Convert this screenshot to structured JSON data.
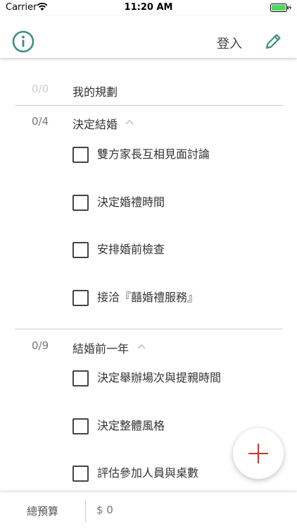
{
  "status_bar": {
    "carrier": "Carrier",
    "time": "11:20 AM"
  },
  "navbar": {
    "login_label": "登入"
  },
  "plan": {
    "header": {
      "count": "0/0",
      "title": "我的規劃"
    }
  },
  "sections": [
    {
      "count": "0/4",
      "title": "決定結婚",
      "items": [
        "雙方家長互相見面討論",
        "決定婚禮時間",
        "安排婚前檢查",
        "接洽『囍婚禮服務』"
      ]
    },
    {
      "count": "0/9",
      "title": "結婚前一年",
      "items": [
        "決定舉辦場次與提親時間",
        "決定整體風格",
        "評估參加人員與桌數"
      ]
    }
  ],
  "footer": {
    "budget_label": "總預算",
    "budget_value": "$ 0"
  },
  "colors": {
    "accent": "#3f8f7f",
    "fab_plus": "#c0392b"
  }
}
